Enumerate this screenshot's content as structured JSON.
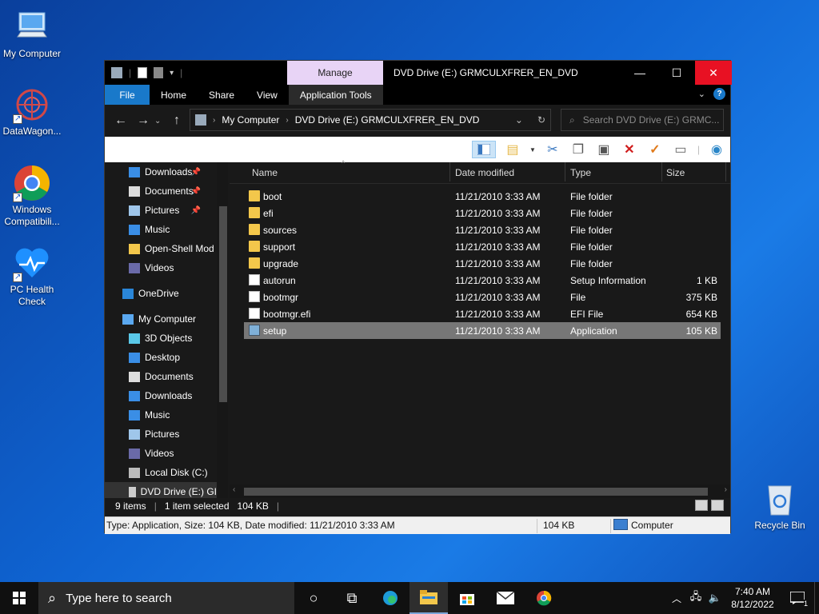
{
  "desktop": {
    "icons": [
      {
        "label": "My Computer"
      },
      {
        "label": "DataWagon..."
      },
      {
        "label": "Windows Compatibili..."
      },
      {
        "label": "PC Health Check"
      },
      {
        "label": "Recycle Bin"
      }
    ]
  },
  "window": {
    "manage_tab": "Manage",
    "title": "DVD Drive (E:) GRMCULXFRER_EN_DVD",
    "controls": {
      "minimize": "—",
      "maximize": "☐",
      "close": "✕"
    }
  },
  "ribbon": {
    "tabs": [
      "File",
      "Home",
      "Share",
      "View",
      "Application Tools"
    ]
  },
  "address": {
    "crumbs": [
      "My Computer",
      "DVD Drive (E:) GRMCULXFRER_EN_DVD"
    ],
    "search_placeholder": "Search DVD Drive (E:) GRMC..."
  },
  "nav": {
    "items": [
      {
        "label": "Downloads",
        "icon": "download-icon",
        "pinned": true
      },
      {
        "label": "Documents",
        "icon": "document-icon",
        "pinned": true
      },
      {
        "label": "Pictures",
        "icon": "pictures-icon",
        "pinned": true
      },
      {
        "label": "Music",
        "icon": "music-icon",
        "pinned": false
      },
      {
        "label": "Open-Shell Mod",
        "icon": "folder-icon",
        "pinned": false
      },
      {
        "label": "Videos",
        "icon": "videos-icon",
        "pinned": false
      },
      {
        "label": "OneDrive",
        "icon": "onedrive-icon",
        "pinned": false
      },
      {
        "label": "My Computer",
        "icon": "computer-icon",
        "pinned": false
      },
      {
        "label": "3D Objects",
        "icon": "3d-objects-icon",
        "pinned": false
      },
      {
        "label": "Desktop",
        "icon": "desktop-icon",
        "pinned": false
      },
      {
        "label": "Documents",
        "icon": "document-icon",
        "pinned": false
      },
      {
        "label": "Downloads",
        "icon": "download-icon",
        "pinned": false
      },
      {
        "label": "Music",
        "icon": "music-icon",
        "pinned": false
      },
      {
        "label": "Pictures",
        "icon": "pictures-icon",
        "pinned": false
      },
      {
        "label": "Videos",
        "icon": "videos-icon",
        "pinned": false
      },
      {
        "label": "Local Disk (C:)",
        "icon": "disk-icon",
        "pinned": false
      },
      {
        "label": "DVD Drive (E:) GI",
        "icon": "dvd-icon",
        "pinned": false
      }
    ]
  },
  "columns": {
    "name": "Name",
    "date": "Date modified",
    "type": "Type",
    "size": "Size"
  },
  "files": [
    {
      "name": "boot",
      "date": "11/21/2010 3:33 AM",
      "type": "File folder",
      "size": "",
      "kind": "folder"
    },
    {
      "name": "efi",
      "date": "11/21/2010 3:33 AM",
      "type": "File folder",
      "size": "",
      "kind": "folder"
    },
    {
      "name": "sources",
      "date": "11/21/2010 3:33 AM",
      "type": "File folder",
      "size": "",
      "kind": "folder"
    },
    {
      "name": "support",
      "date": "11/21/2010 3:33 AM",
      "type": "File folder",
      "size": "",
      "kind": "folder"
    },
    {
      "name": "upgrade",
      "date": "11/21/2010 3:33 AM",
      "type": "File folder",
      "size": "",
      "kind": "folder"
    },
    {
      "name": "autorun",
      "date": "11/21/2010 3:33 AM",
      "type": "Setup Information",
      "size": "1 KB",
      "kind": "file"
    },
    {
      "name": "bootmgr",
      "date": "11/21/2010 3:33 AM",
      "type": "File",
      "size": "375 KB",
      "kind": "file"
    },
    {
      "name": "bootmgr.efi",
      "date": "11/21/2010 3:33 AM",
      "type": "EFI File",
      "size": "654 KB",
      "kind": "file"
    },
    {
      "name": "setup",
      "date": "11/21/2010 3:33 AM",
      "type": "Application",
      "size": "105 KB",
      "kind": "app",
      "selected": true
    }
  ],
  "status": {
    "count": "9 items",
    "selected": "1 item selected",
    "selected_size": "104 KB",
    "detail": "Type: Application, Size: 104 KB, Date modified: 11/21/2010 3:33 AM",
    "detail_size": "104 KB",
    "location": "Computer"
  },
  "taskbar": {
    "search_placeholder": "Type here to search",
    "time": "7:40 AM",
    "date": "8/12/2022",
    "notifications": "1"
  }
}
